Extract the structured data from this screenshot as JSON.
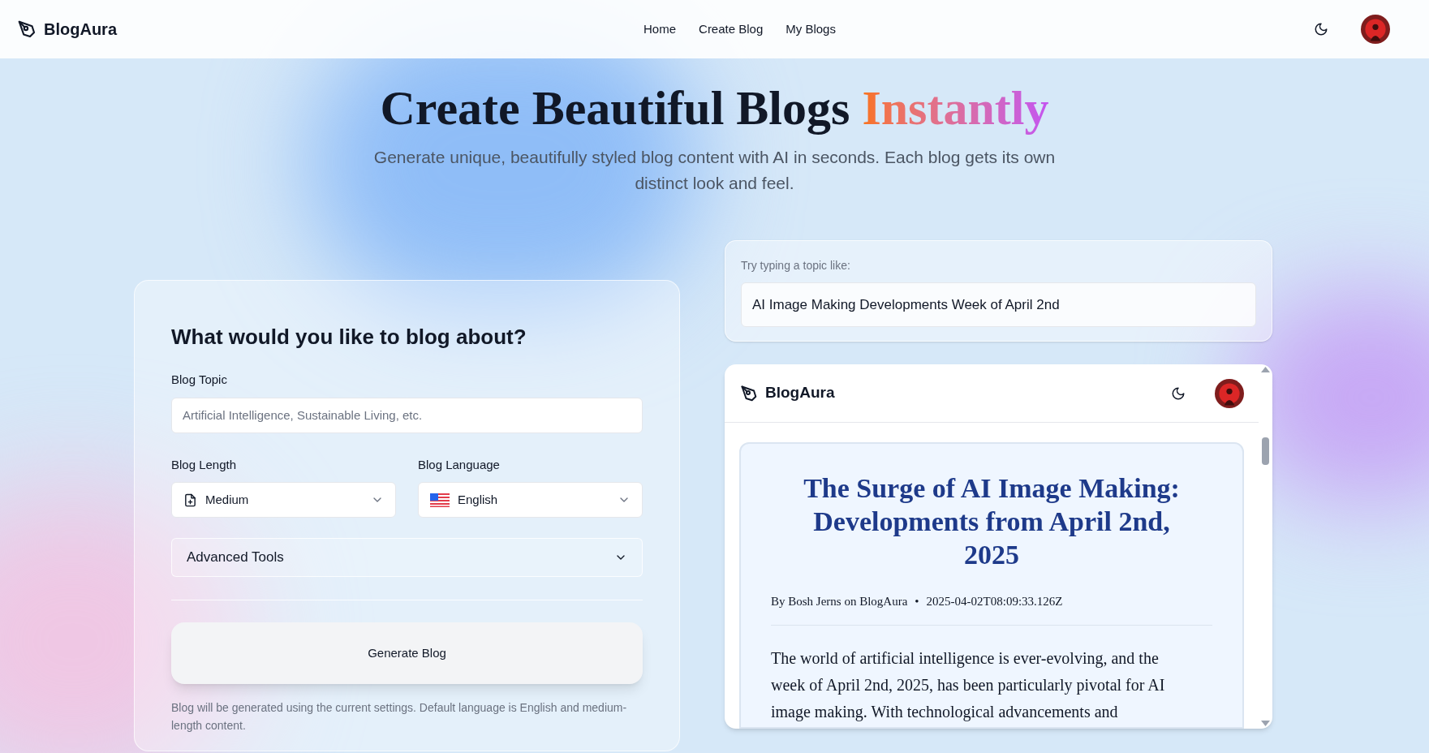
{
  "header": {
    "brand": "BlogAura",
    "nav": [
      {
        "label": "Home"
      },
      {
        "label": "Create Blog"
      },
      {
        "label": "My Blogs"
      }
    ]
  },
  "hero": {
    "title": "Create Beautiful Blogs",
    "title_highlight": "Instantly",
    "subtitle": "Generate unique, beautifully styled blog content with AI in seconds. Each blog gets its own distinct look and feel."
  },
  "form": {
    "heading": "What would you like to blog about?",
    "topic": {
      "label": "Blog Topic",
      "placeholder": "Artificial Intelligence, Sustainable Living, etc."
    },
    "length": {
      "label": "Blog Length",
      "value": "Medium"
    },
    "language": {
      "label": "Blog Language",
      "value": "English"
    },
    "advanced": {
      "label": "Advanced Tools",
      "expanded": false
    },
    "generate_button": "Generate Blog",
    "note": "Blog will be generated using the current settings. Default language is English and medium-length content."
  },
  "suggestion": {
    "label": "Try typing a topic like:",
    "value": "AI Image Making Developments Week of April 2nd"
  },
  "preview": {
    "brand": "BlogAura",
    "title": "The Surge of AI Image Making: Developments from April 2nd, 2025",
    "byline": "By Bosh Jerns on BlogAura",
    "separator": "•",
    "date": "2025-04-02T08:09:33.126Z",
    "body": "The world of artificial intelligence is ever-evolving, and the week of April 2nd, 2025, has been particularly pivotal for AI image making. With technological advancements and"
  }
}
